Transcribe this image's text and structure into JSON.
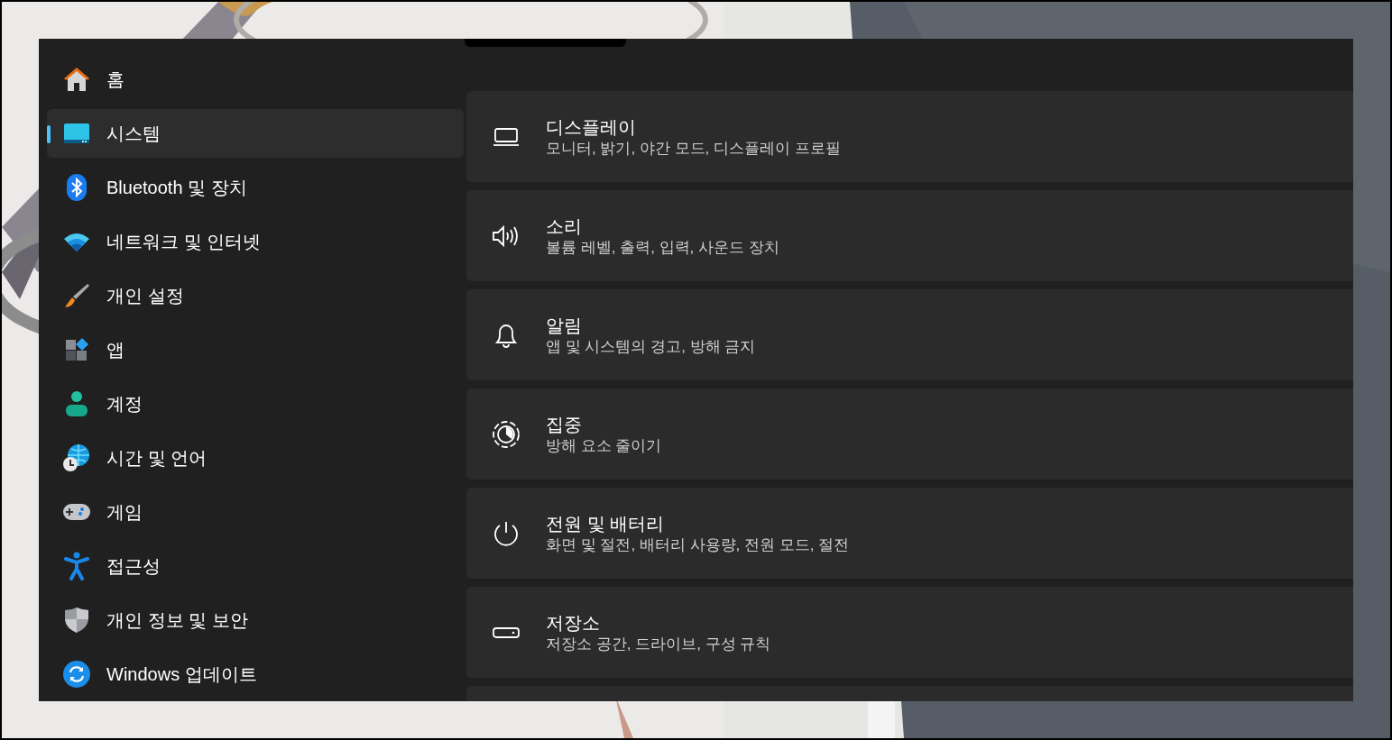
{
  "sidebar": {
    "items": [
      {
        "label": "홈",
        "selected": false
      },
      {
        "label": "시스템",
        "selected": true
      },
      {
        "label": "Bluetooth 및 장치",
        "selected": false
      },
      {
        "label": "네트워크 및 인터넷",
        "selected": false
      },
      {
        "label": "개인 설정",
        "selected": false
      },
      {
        "label": "앱",
        "selected": false
      },
      {
        "label": "계정",
        "selected": false
      },
      {
        "label": "시간 및 언어",
        "selected": false
      },
      {
        "label": "게임",
        "selected": false
      },
      {
        "label": "접근성",
        "selected": false
      },
      {
        "label": "개인 정보 및 보안",
        "selected": false
      },
      {
        "label": "Windows 업데이트",
        "selected": false
      }
    ]
  },
  "settings": [
    {
      "title": "디스플레이",
      "description": "모니터, 밝기, 야간 모드, 디스플레이 프로필"
    },
    {
      "title": "소리",
      "description": "볼륨 레벨, 출력, 입력, 사운드 장치"
    },
    {
      "title": "알림",
      "description": "앱 및 시스템의 경고, 방해 금지"
    },
    {
      "title": "집중",
      "description": "방해 요소 줄이기"
    },
    {
      "title": "전원 및 배터리",
      "description": "화면 및 절전, 배터리 사용량, 전원 모드, 절전"
    },
    {
      "title": "저장소",
      "description": "저장소 공간, 드라이브, 구성 규칙"
    }
  ]
}
